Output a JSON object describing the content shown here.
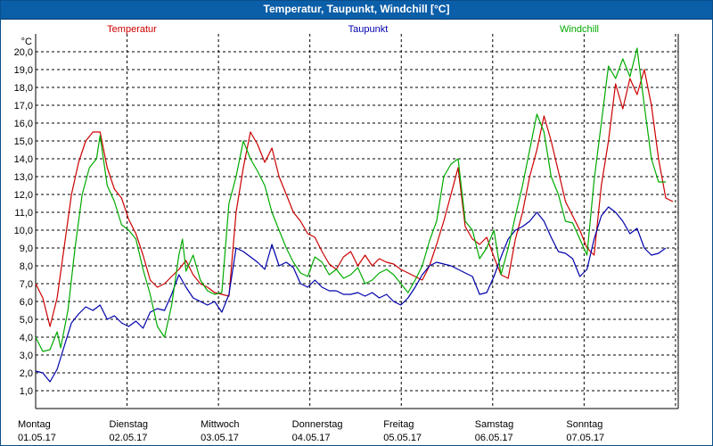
{
  "window": {
    "title": "Temperatur, Taupunkt, Windchill [°C]"
  },
  "chart_data": {
    "type": "line",
    "unit": "°C",
    "ylim": [
      0,
      21
    ],
    "xlim": [
      0,
      7
    ],
    "grid": true,
    "y_ticks": [
      "1,0",
      "2,0",
      "3,0",
      "4,0",
      "5,0",
      "6,0",
      "7,0",
      "8,0",
      "9,0",
      "10,0",
      "11,0",
      "12,0",
      "13,0",
      "14,0",
      "15,0",
      "16,0",
      "17,0",
      "18,0",
      "19,0",
      "20,0"
    ],
    "days": [
      {
        "name": "Montag",
        "date": "01.05.17"
      },
      {
        "name": "Dienstag",
        "date": "02.05.17"
      },
      {
        "name": "Mittwoch",
        "date": "03.05.17"
      },
      {
        "name": "Donnerstag",
        "date": "04.05.17"
      },
      {
        "name": "Freitag",
        "date": "05.05.17"
      },
      {
        "name": "Samstag",
        "date": "06.05.17"
      },
      {
        "name": "Sonntag",
        "date": "07.05.17"
      }
    ],
    "legend_position": "top",
    "series": [
      {
        "name": "Temperatur",
        "color": "#cc0000",
        "points": [
          [
            0,
            7.0
          ],
          [
            0.1,
            6.2
          ],
          [
            0.2,
            4.6
          ],
          [
            0.3,
            6.2
          ],
          [
            0.5,
            12.0
          ],
          [
            0.6,
            13.8
          ],
          [
            0.7,
            15.0
          ],
          [
            0.8,
            15.5
          ],
          [
            0.9,
            15.5
          ],
          [
            1.0,
            13.5
          ],
          [
            1.1,
            12.3
          ],
          [
            1.2,
            11.8
          ],
          [
            1.3,
            10.6
          ],
          [
            1.4,
            9.8
          ],
          [
            1.5,
            8.6
          ],
          [
            1.6,
            7.2
          ],
          [
            1.7,
            6.8
          ],
          [
            1.8,
            7.0
          ],
          [
            1.9,
            7.4
          ],
          [
            2.0,
            7.8
          ],
          [
            2.1,
            8.3
          ],
          [
            2.2,
            7.5
          ],
          [
            2.3,
            7.0
          ],
          [
            2.4,
            6.8
          ],
          [
            2.5,
            6.5
          ],
          [
            2.6,
            6.4
          ],
          [
            2.7,
            6.3
          ],
          [
            2.8,
            11.0
          ],
          [
            2.9,
            13.5
          ],
          [
            3.0,
            15.5
          ],
          [
            3.1,
            14.8
          ],
          [
            3.2,
            13.8
          ],
          [
            3.3,
            14.6
          ],
          [
            3.4,
            13.0
          ],
          [
            3.5,
            12.0
          ],
          [
            3.6,
            11.0
          ],
          [
            3.7,
            10.5
          ],
          [
            3.8,
            9.8
          ],
          [
            3.9,
            9.6
          ],
          [
            4.0,
            8.8
          ],
          [
            4.1,
            8.1
          ],
          [
            4.2,
            7.8
          ],
          [
            4.3,
            8.5
          ],
          [
            4.4,
            8.8
          ],
          [
            4.5,
            8.0
          ],
          [
            4.6,
            8.6
          ],
          [
            4.7,
            8.0
          ],
          [
            4.8,
            8.4
          ],
          [
            4.9,
            8.2
          ],
          [
            5.0,
            8.1
          ],
          [
            5.1,
            7.8
          ],
          [
            5.2,
            7.6
          ],
          [
            5.3,
            7.4
          ],
          [
            5.4,
            7.2
          ],
          [
            5.5,
            8.0
          ],
          [
            5.6,
            9.2
          ],
          [
            5.7,
            10.5
          ],
          [
            5.8,
            12.0
          ],
          [
            5.9,
            13.5
          ],
          [
            6.0,
            10.2
          ],
          [
            6.1,
            9.5
          ],
          [
            6.2,
            9.2
          ],
          [
            6.3,
            9.6
          ],
          [
            6.4,
            8.5
          ],
          [
            6.5,
            7.5
          ],
          [
            6.6,
            7.3
          ],
          [
            6.7,
            9.5
          ],
          [
            6.8,
            11.0
          ],
          [
            6.9,
            13.0
          ],
          [
            7.0,
            14.5
          ],
          [
            7.1,
            16.4
          ],
          [
            7.2,
            15.0
          ],
          [
            7.3,
            13.3
          ],
          [
            7.4,
            11.6
          ],
          [
            7.5,
            10.8
          ],
          [
            7.6,
            10.0
          ],
          [
            7.7,
            9.0
          ],
          [
            7.8,
            8.6
          ],
          [
            7.9,
            12.5
          ],
          [
            8.0,
            15.0
          ],
          [
            8.1,
            18.2
          ],
          [
            8.2,
            16.8
          ],
          [
            8.3,
            18.5
          ],
          [
            8.4,
            17.6
          ],
          [
            8.5,
            19.0
          ],
          [
            8.6,
            17.0
          ],
          [
            8.7,
            14.0
          ],
          [
            8.8,
            11.8
          ],
          [
            8.9,
            11.6
          ]
        ]
      },
      {
        "name": "Taupunkt",
        "color": "#0000aa",
        "points": [
          [
            0,
            2.1
          ],
          [
            0.1,
            2.0
          ],
          [
            0.2,
            1.5
          ],
          [
            0.3,
            2.2
          ],
          [
            0.4,
            3.5
          ],
          [
            0.5,
            4.8
          ],
          [
            0.6,
            5.3
          ],
          [
            0.7,
            5.7
          ],
          [
            0.8,
            5.5
          ],
          [
            0.9,
            5.8
          ],
          [
            1.0,
            5.0
          ],
          [
            1.1,
            5.2
          ],
          [
            1.2,
            4.8
          ],
          [
            1.3,
            4.6
          ],
          [
            1.4,
            4.9
          ],
          [
            1.5,
            4.5
          ],
          [
            1.6,
            5.4
          ],
          [
            1.7,
            5.6
          ],
          [
            1.8,
            5.5
          ],
          [
            1.9,
            6.4
          ],
          [
            2.0,
            7.5
          ],
          [
            2.1,
            6.8
          ],
          [
            2.2,
            6.2
          ],
          [
            2.3,
            6.0
          ],
          [
            2.4,
            5.8
          ],
          [
            2.5,
            6.0
          ],
          [
            2.6,
            5.4
          ],
          [
            2.7,
            6.4
          ],
          [
            2.8,
            9.0
          ],
          [
            2.9,
            8.8
          ],
          [
            3.0,
            8.5
          ],
          [
            3.1,
            8.2
          ],
          [
            3.2,
            7.8
          ],
          [
            3.3,
            9.2
          ],
          [
            3.4,
            8.0
          ],
          [
            3.5,
            8.2
          ],
          [
            3.6,
            7.9
          ],
          [
            3.7,
            7.0
          ],
          [
            3.8,
            6.8
          ],
          [
            3.9,
            7.2
          ],
          [
            4.0,
            6.8
          ],
          [
            4.1,
            6.6
          ],
          [
            4.2,
            6.6
          ],
          [
            4.3,
            6.4
          ],
          [
            4.4,
            6.4
          ],
          [
            4.5,
            6.5
          ],
          [
            4.6,
            6.3
          ],
          [
            4.7,
            6.5
          ],
          [
            4.8,
            6.2
          ],
          [
            4.9,
            6.4
          ],
          [
            5.0,
            6.0
          ],
          [
            5.1,
            5.8
          ],
          [
            5.2,
            6.2
          ],
          [
            5.3,
            6.8
          ],
          [
            5.4,
            7.5
          ],
          [
            5.5,
            8.0
          ],
          [
            5.6,
            8.2
          ],
          [
            5.7,
            8.1
          ],
          [
            5.8,
            8.0
          ],
          [
            5.9,
            7.8
          ],
          [
            6.0,
            7.6
          ],
          [
            6.1,
            7.4
          ],
          [
            6.2,
            6.4
          ],
          [
            6.3,
            6.5
          ],
          [
            6.4,
            7.4
          ],
          [
            6.5,
            8.5
          ],
          [
            6.6,
            9.5
          ],
          [
            6.7,
            10.0
          ],
          [
            6.8,
            10.2
          ],
          [
            6.9,
            10.5
          ],
          [
            7.0,
            11.0
          ],
          [
            7.1,
            10.5
          ],
          [
            7.2,
            9.6
          ],
          [
            7.3,
            8.8
          ],
          [
            7.4,
            8.7
          ],
          [
            7.5,
            8.4
          ],
          [
            7.6,
            7.4
          ],
          [
            7.7,
            7.8
          ],
          [
            7.8,
            9.5
          ],
          [
            7.9,
            10.8
          ],
          [
            8.0,
            11.3
          ],
          [
            8.1,
            11.0
          ],
          [
            8.2,
            10.5
          ],
          [
            8.3,
            9.8
          ],
          [
            8.4,
            10.1
          ],
          [
            8.5,
            9.0
          ],
          [
            8.6,
            8.6
          ],
          [
            8.7,
            8.7
          ],
          [
            8.8,
            9.0
          ]
        ]
      },
      {
        "name": "Windchill",
        "color": "#00aa00",
        "points": [
          [
            0,
            4.0
          ],
          [
            0.1,
            3.2
          ],
          [
            0.2,
            3.3
          ],
          [
            0.3,
            4.3
          ],
          [
            0.35,
            3.4
          ],
          [
            0.45,
            5.5
          ],
          [
            0.55,
            9.0
          ],
          [
            0.65,
            12.0
          ],
          [
            0.75,
            13.5
          ],
          [
            0.85,
            14.0
          ],
          [
            0.9,
            15.3
          ],
          [
            1.0,
            12.5
          ],
          [
            1.1,
            11.6
          ],
          [
            1.2,
            10.3
          ],
          [
            1.3,
            10.0
          ],
          [
            1.4,
            9.5
          ],
          [
            1.5,
            7.8
          ],
          [
            1.6,
            6.4
          ],
          [
            1.7,
            4.6
          ],
          [
            1.8,
            4.0
          ],
          [
            1.9,
            5.8
          ],
          [
            2.0,
            8.6
          ],
          [
            2.05,
            9.5
          ],
          [
            2.1,
            7.7
          ],
          [
            2.2,
            8.6
          ],
          [
            2.3,
            7.2
          ],
          [
            2.4,
            6.6
          ],
          [
            2.5,
            6.4
          ],
          [
            2.6,
            6.5
          ],
          [
            2.7,
            11.5
          ],
          [
            2.8,
            13.0
          ],
          [
            2.9,
            15.0
          ],
          [
            3.0,
            14.0
          ],
          [
            3.1,
            13.3
          ],
          [
            3.2,
            12.5
          ],
          [
            3.3,
            11.0
          ],
          [
            3.4,
            10.0
          ],
          [
            3.5,
            9.0
          ],
          [
            3.6,
            8.2
          ],
          [
            3.7,
            7.6
          ],
          [
            3.8,
            7.4
          ],
          [
            3.9,
            8.5
          ],
          [
            4.0,
            8.2
          ],
          [
            4.1,
            7.5
          ],
          [
            4.2,
            7.8
          ],
          [
            4.3,
            7.3
          ],
          [
            4.4,
            7.5
          ],
          [
            4.5,
            7.9
          ],
          [
            4.6,
            7.0
          ],
          [
            4.7,
            7.2
          ],
          [
            4.8,
            7.6
          ],
          [
            4.9,
            7.8
          ],
          [
            5.0,
            7.5
          ],
          [
            5.1,
            7.0
          ],
          [
            5.2,
            6.5
          ],
          [
            5.3,
            7.2
          ],
          [
            5.4,
            8.0
          ],
          [
            5.5,
            9.4
          ],
          [
            5.6,
            10.5
          ],
          [
            5.7,
            13.0
          ],
          [
            5.8,
            13.7
          ],
          [
            5.9,
            14.0
          ],
          [
            6.0,
            10.5
          ],
          [
            6.1,
            10.0
          ],
          [
            6.2,
            8.4
          ],
          [
            6.3,
            9.0
          ],
          [
            6.4,
            10.0
          ],
          [
            6.5,
            7.5
          ],
          [
            6.6,
            9.0
          ],
          [
            6.7,
            10.8
          ],
          [
            6.8,
            12.5
          ],
          [
            6.9,
            14.5
          ],
          [
            7.0,
            16.5
          ],
          [
            7.1,
            15.5
          ],
          [
            7.2,
            13.0
          ],
          [
            7.3,
            12.0
          ],
          [
            7.4,
            10.5
          ],
          [
            7.5,
            10.4
          ],
          [
            7.6,
            9.5
          ],
          [
            7.7,
            8.6
          ],
          [
            7.8,
            12.8
          ],
          [
            7.9,
            16.0
          ],
          [
            8.0,
            19.2
          ],
          [
            8.1,
            18.5
          ],
          [
            8.2,
            19.6
          ],
          [
            8.3,
            18.6
          ],
          [
            8.4,
            20.2
          ],
          [
            8.5,
            17.0
          ],
          [
            8.6,
            14.0
          ],
          [
            8.7,
            12.7
          ],
          [
            8.8,
            12.7
          ]
        ]
      }
    ]
  }
}
